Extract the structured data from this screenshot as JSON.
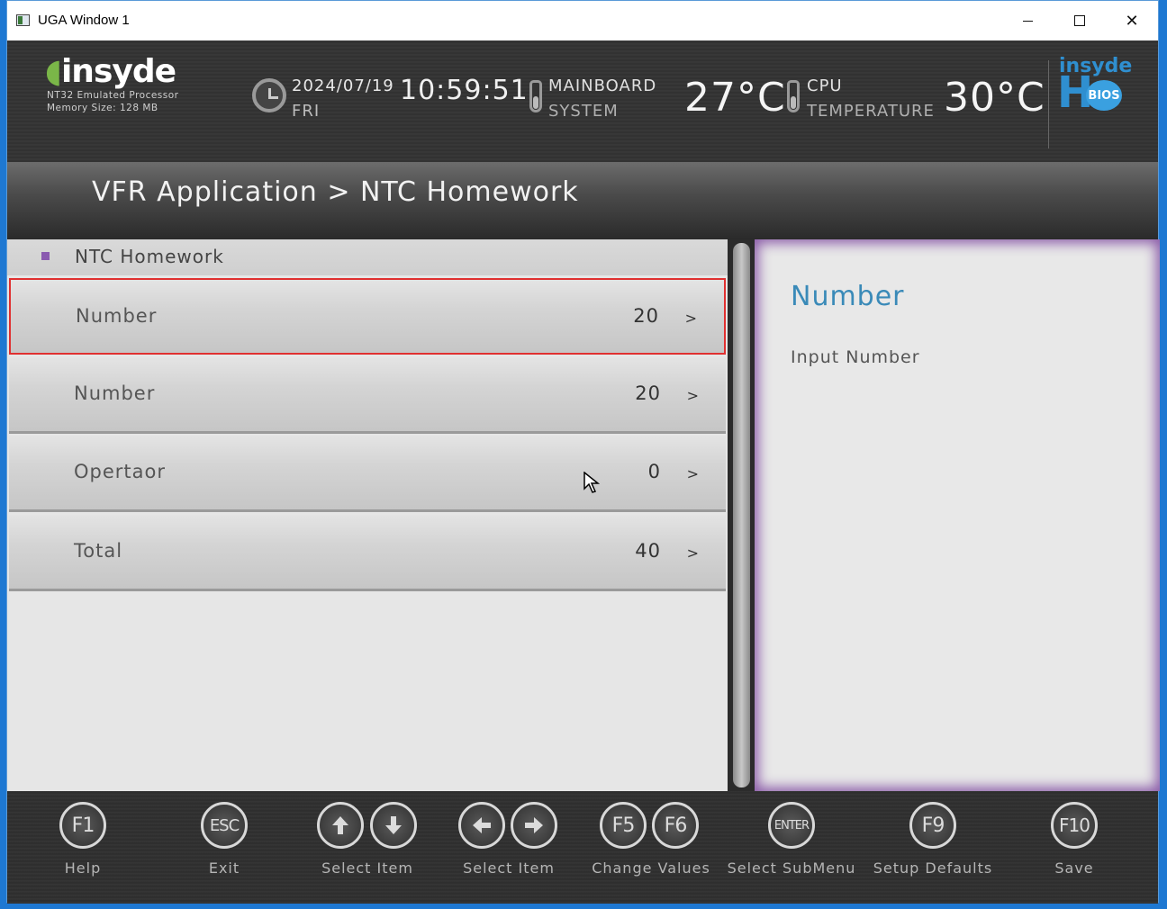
{
  "window": {
    "title": "UGA Window 1"
  },
  "header": {
    "logo": "insyde",
    "processor": "NT32 Emulated Processor",
    "memory": "Memory Size: 128 MB",
    "date": "2024/07/19",
    "day": "FRI",
    "time": "10:59:51",
    "mainboard_label_top": "MAINBOARD",
    "mainboard_label_bottom": "SYSTEM",
    "mainboard_temp": "27°C",
    "cpu_label_top": "CPU",
    "cpu_label_bottom": "TEMPERATURE",
    "cpu_temp": "30°C",
    "brand_top": "insyde",
    "brand_h": "H",
    "brand_bios": "BIOS"
  },
  "breadcrumb": "VFR Application > NTC Homework",
  "section": {
    "title": "NTC Homework",
    "accent": "#8a5ab0"
  },
  "rows": [
    {
      "label": "Number",
      "value": "20",
      "arrow": ">"
    },
    {
      "label": "Number",
      "value": "20",
      "arrow": ">"
    },
    {
      "label": "Opertaor",
      "value": "0",
      "arrow": ">"
    },
    {
      "label": "Total",
      "value": "40",
      "arrow": ">"
    }
  ],
  "help": {
    "title": "Number",
    "text": "Input Number"
  },
  "footer": {
    "keys": [
      {
        "key": "F1",
        "label": "Help"
      },
      {
        "key": "ESC",
        "label": "Exit"
      },
      {
        "label": "Select Item"
      },
      {
        "label": "Select Item"
      },
      {
        "key": "F5",
        "key2": "F6",
        "label": "Change Values"
      },
      {
        "key": "ENTER",
        "label": "Select  SubMenu"
      },
      {
        "key": "F9",
        "label": "Setup  Defaults"
      },
      {
        "key": "F10",
        "label": "Save"
      }
    ]
  },
  "colors": {
    "selection_border": "#e03030",
    "help_title": "#3a8ab8",
    "pane_glow": "#8a5aa8"
  }
}
